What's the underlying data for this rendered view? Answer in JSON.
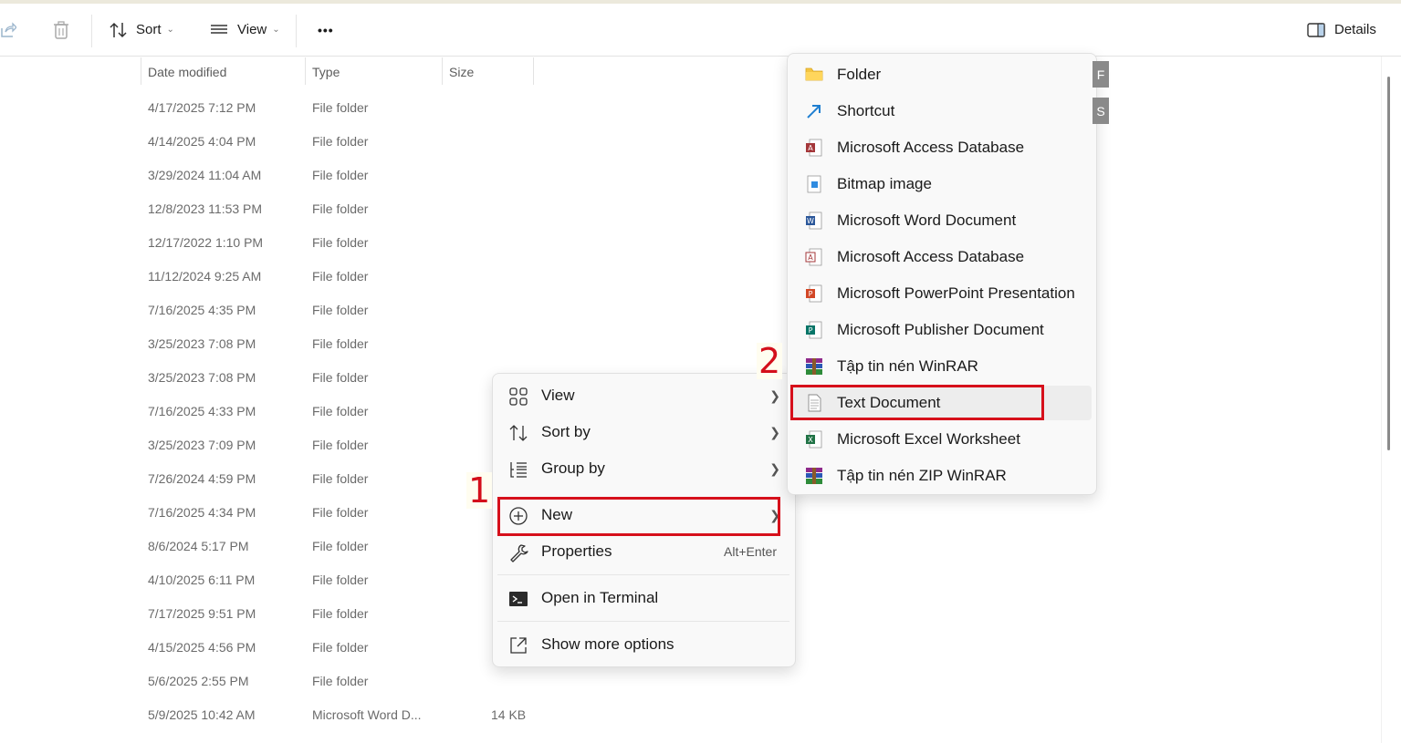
{
  "toolbar": {
    "sort_label": "Sort",
    "view_label": "View",
    "more_label": "•••",
    "details_label": "Details"
  },
  "columns": [
    "Date modified",
    "Type",
    "Size"
  ],
  "rows": [
    {
      "date": "4/17/2025 7:12 PM",
      "type": "File folder",
      "size": ""
    },
    {
      "date": "4/14/2025 4:04 PM",
      "type": "File folder",
      "size": ""
    },
    {
      "date": "3/29/2024 11:04 AM",
      "type": "File folder",
      "size": ""
    },
    {
      "date": "12/8/2023 11:53 PM",
      "type": "File folder",
      "size": ""
    },
    {
      "date": "12/17/2022 1:10 PM",
      "type": "File folder",
      "size": ""
    },
    {
      "date": "11/12/2024 9:25 AM",
      "type": "File folder",
      "size": ""
    },
    {
      "date": "7/16/2025 4:35 PM",
      "type": "File folder",
      "size": ""
    },
    {
      "date": "3/25/2023 7:08 PM",
      "type": "File folder",
      "size": ""
    },
    {
      "date": "3/25/2023 7:08 PM",
      "type": "File folder",
      "size": ""
    },
    {
      "date": "7/16/2025 4:33 PM",
      "type": "File folder",
      "size": ""
    },
    {
      "date": "3/25/2023 7:09 PM",
      "type": "File folder",
      "size": ""
    },
    {
      "date": "7/26/2024 4:59 PM",
      "type": "File folder",
      "size": ""
    },
    {
      "date": "7/16/2025 4:34 PM",
      "type": "File folder",
      "size": ""
    },
    {
      "date": "8/6/2024 5:17 PM",
      "type": "File folder",
      "size": ""
    },
    {
      "date": "4/10/2025 6:11 PM",
      "type": "File folder",
      "size": ""
    },
    {
      "date": "7/17/2025 9:51 PM",
      "type": "File folder",
      "size": ""
    },
    {
      "date": "4/15/2025 4:56 PM",
      "type": "File folder",
      "size": ""
    },
    {
      "date": "5/6/2025 2:55 PM",
      "type": "File folder",
      "size": ""
    },
    {
      "date": "5/9/2025 10:42 AM",
      "type": "Microsoft Word D...",
      "size": "14 KB"
    }
  ],
  "context_menu": {
    "items": [
      {
        "label": "View",
        "icon": "grid-icon"
      },
      {
        "label": "Sort by",
        "icon": "sort-icon"
      },
      {
        "label": "Group by",
        "icon": "group-icon"
      },
      {
        "label": "New",
        "icon": "plus-circle-icon"
      },
      {
        "label": "Properties",
        "icon": "wrench-icon",
        "shortcut": "Alt+Enter"
      },
      {
        "label": "Open in Terminal",
        "icon": "terminal-icon"
      },
      {
        "label": "Show more options",
        "icon": "share-box-icon"
      }
    ]
  },
  "new_submenu": {
    "items": [
      {
        "label": "Folder",
        "icon": "folder-icon",
        "accel": "F"
      },
      {
        "label": "Shortcut",
        "icon": "shortcut-arrow-icon",
        "accel": "S"
      },
      {
        "label": "Microsoft Access Database",
        "icon": "access-icon"
      },
      {
        "label": "Bitmap image",
        "icon": "bitmap-icon"
      },
      {
        "label": "Microsoft Word Document",
        "icon": "word-icon"
      },
      {
        "label": "Microsoft Access Database",
        "icon": "access-icon"
      },
      {
        "label": "Microsoft PowerPoint Presentation",
        "icon": "powerpoint-icon"
      },
      {
        "label": "Microsoft Publisher Document",
        "icon": "publisher-icon"
      },
      {
        "label": "Tập tin nén WinRAR",
        "icon": "winrar-icon"
      },
      {
        "label": "Text Document",
        "icon": "text-document-icon"
      },
      {
        "label": "Microsoft Excel Worksheet",
        "icon": "excel-icon"
      },
      {
        "label": "Tập tin nén ZIP WinRAR",
        "icon": "winrar-zip-icon"
      }
    ]
  },
  "annotations": {
    "step1": "1",
    "step2": "2"
  },
  "colors": {
    "highlight_red": "#d6101b",
    "menu_bg": "#f9f9f9"
  }
}
